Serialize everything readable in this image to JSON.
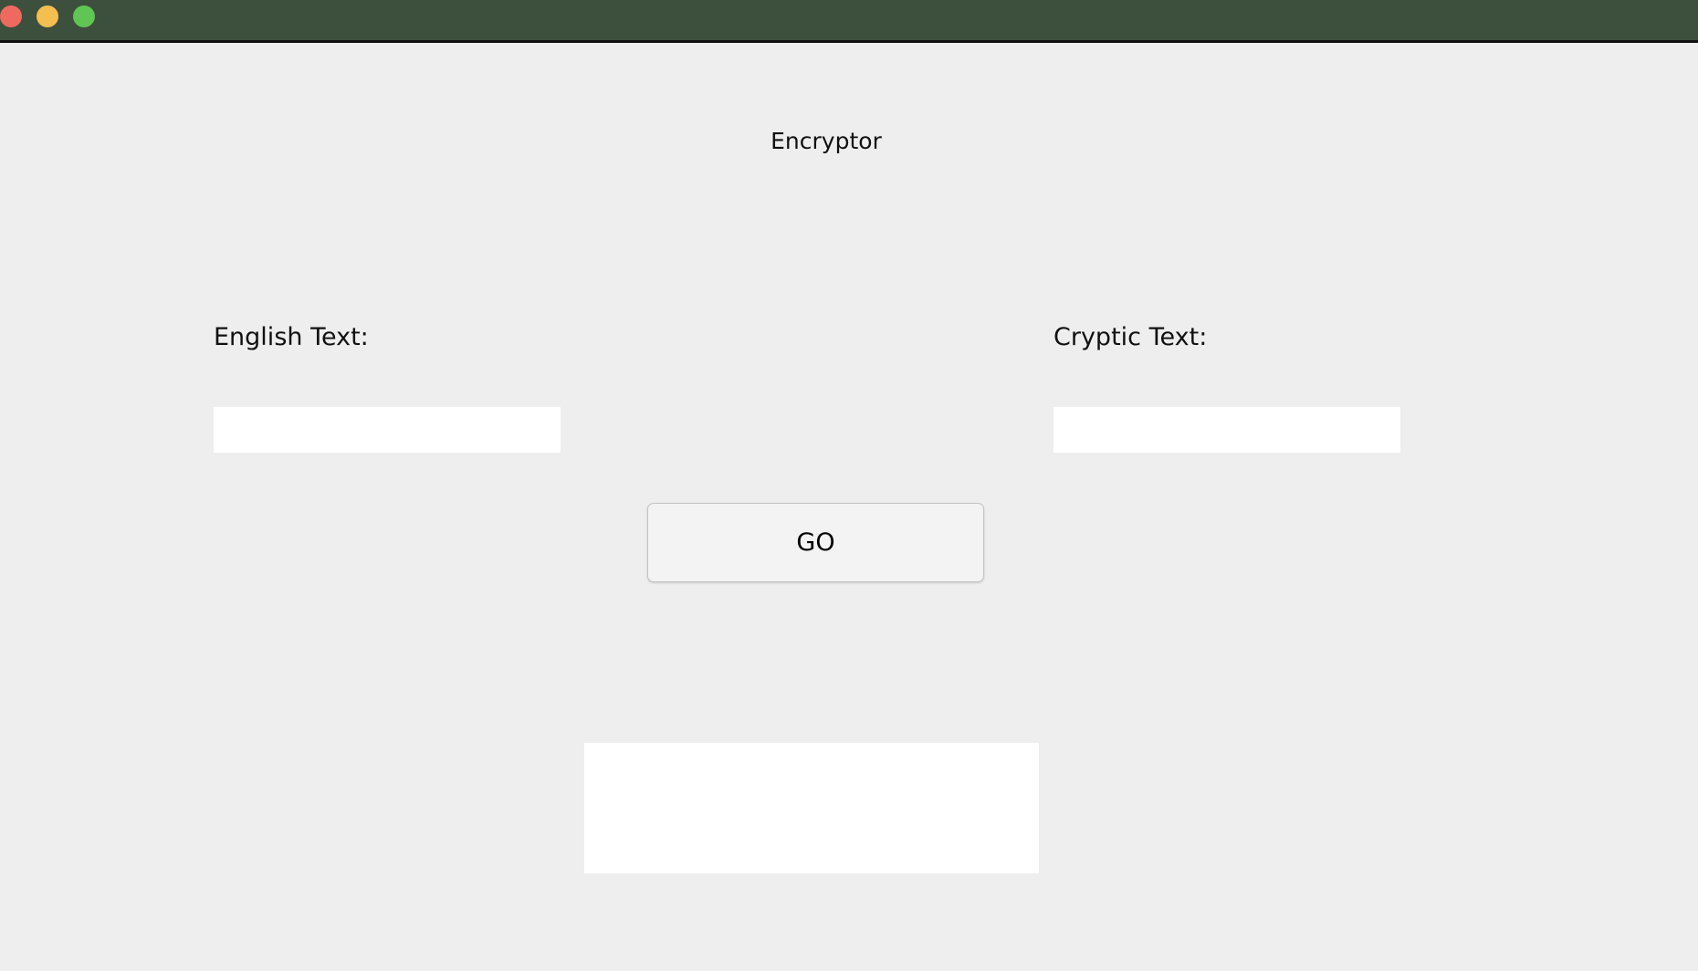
{
  "window": {
    "controls": {
      "close_color": "#ee6a5f",
      "minimize_color": "#f5bf4f",
      "zoom_color": "#61c554"
    }
  },
  "app": {
    "title": "Encryptor"
  },
  "form": {
    "english_label": "English Text:",
    "english_value": "",
    "cryptic_label": "Cryptic Text:",
    "cryptic_value": "",
    "go_label": "GO",
    "output_text": ""
  }
}
